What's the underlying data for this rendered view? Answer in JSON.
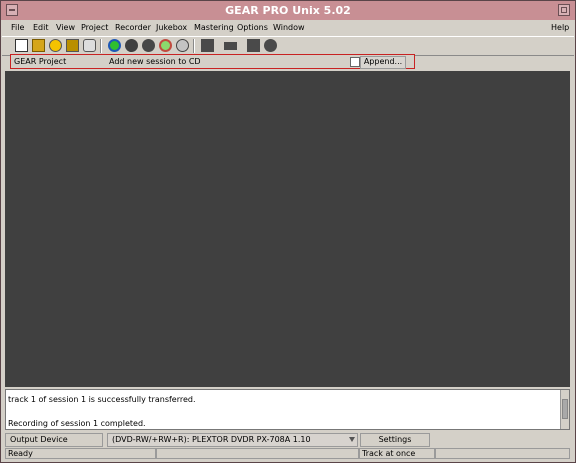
{
  "window": {
    "title": "GEAR PRO Unix 5.02"
  },
  "menu": [
    "File",
    "Edit",
    "View",
    "Project",
    "Recorder",
    "Jukebox",
    "Mastering",
    "Options",
    "Window",
    "Help"
  ],
  "project_bar": {
    "name": "GEAR Project",
    "action": "Add new session to CD",
    "append_label": "Append..."
  },
  "log": {
    "lines": [
      "track 1 of session 1 is successfully transferred.",
      "",
      "Recording of session 1 completed."
    ]
  },
  "output": {
    "label": "Output Device",
    "device": "(DVD-RW/+RW+R):  PLEXTOR DVDR   PX-708A 1.10",
    "settings_label": "Settings"
  },
  "status": {
    "left": "Ready",
    "right": "Track at once"
  },
  "colors": {
    "titlebar": "#c88f94",
    "workspace": "#404040",
    "highlight_border": "#c82222"
  },
  "toolbar_icons": [
    "new-document-icon",
    "open-folder-icon",
    "cd-add-icon",
    "folder-open-icon",
    "hand-icon",
    "info-icon",
    "gray-disc-icon",
    "gray-cd-icon",
    "disc-green-icon",
    "disc-check-icon",
    "stop-icon",
    "drive-icon",
    "folder-icon",
    "chat-icon"
  ]
}
